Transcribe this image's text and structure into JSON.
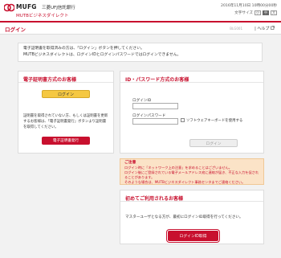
{
  "header": {
    "logo_text": "MUFG",
    "bank_name": "三菱UFJ信託銀行",
    "service_name": "MUTBビジネスダイレクト",
    "datetime": "2016年11月10日 10時00分00秒",
    "font_size_label": "文字サイズ",
    "font_size_options": [
      "小",
      "中",
      "大"
    ],
    "colors": {
      "brand_red": "#c8102e"
    }
  },
  "titlebar": {
    "title": "ログイン",
    "screen_id": "BLG001",
    "help_label": "ヘルプ"
  },
  "notice": {
    "line1": "電子証明書を取得済みの方は、「ログイン」ボタンを押してください。",
    "line2": "MUTBビジネスダイレクトは、ログインIDとログインパスワードではログインできません。"
  },
  "cert_panel": {
    "title": "電子証明書方式のお客様",
    "login_button": "ログイン",
    "text1": "証明書を取得されていない方、もしくは証明書を更新",
    "text2": "するお客様は、「電子証明書発行」ボタンより証明書",
    "text3": "を取得してください。",
    "issue_button": "電子証明書発行"
  },
  "idpw_panel": {
    "title": "ID・パスワード方式のお客様",
    "id_label": "ログインID",
    "id_value": "",
    "pw_label": "ログインパスワード",
    "pw_value": "",
    "keyboard_label": "ソフトウェアキーボードを使用する",
    "login_button": "ログイン"
  },
  "warning": {
    "heading": "ご注意",
    "line1": "ログイン時に「ネットワーク上の注意」を求めることはございません。",
    "line2": "ログイン後にご登録されている電子メールアドレス宛に連絡が届き、不正な入力を促されることがあります。",
    "line3": "そのような場合は、MUTBビジネスダイレクト事務センタまでご連絡ください。"
  },
  "first_panel": {
    "title": "初めてご利用されるお客様",
    "text": "マスターユーザとなる方が、最初にログインID取得を行ってください。",
    "button": "ログインID取得"
  }
}
